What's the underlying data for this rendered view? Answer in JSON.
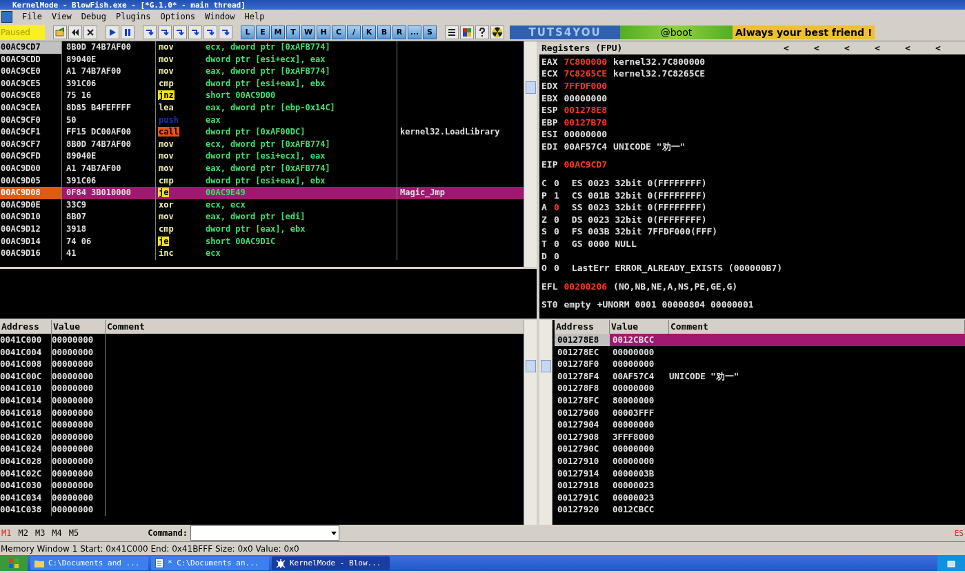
{
  "window": {
    "title": "KernelMode - BlowFish.exe - [*G.1.0* - main thread]"
  },
  "menu": [
    {
      "label": "File"
    },
    {
      "label": "View"
    },
    {
      "label": "Debug"
    },
    {
      "label": "Plugins"
    },
    {
      "label": "Options"
    },
    {
      "label": "Window"
    },
    {
      "label": "Help"
    }
  ],
  "toolbar": {
    "status": "Paused",
    "letter_buttons": [
      "L",
      "E",
      "M",
      "T",
      "W",
      "H",
      "C",
      "/",
      "K",
      "B",
      "R",
      "...",
      "S"
    ],
    "banner": {
      "logo": "TUTS4YOU",
      "tag": "@boot",
      "slogan": "Always your best friend !"
    }
  },
  "disassembly": {
    "rows": [
      {
        "address": "00AC9CD7",
        "hex": "8B0D 74B7AF00",
        "mnemonic": "mov",
        "kind": "plain",
        "operand": "ecx, dword ptr [0xAFB774]",
        "eip": true,
        "selected": false
      },
      {
        "address": "00AC9CDD",
        "hex": "89040E",
        "mnemonic": "mov",
        "kind": "plain",
        "operand": "dword ptr [esi+ecx], eax",
        "eip": false,
        "selected": false
      },
      {
        "address": "00AC9CE0",
        "hex": "A1 74B7AF00",
        "mnemonic": "mov",
        "kind": "plain",
        "operand": "eax, dword ptr [0xAFB774]",
        "eip": false,
        "selected": false
      },
      {
        "address": "00AC9CE5",
        "hex": "391C06",
        "mnemonic": "cmp",
        "kind": "plain",
        "operand": "dword ptr [esi+eax], ebx",
        "eip": false,
        "selected": false
      },
      {
        "address": "00AC9CE8",
        "hex": "75 16",
        "mnemonic": "jnz",
        "kind": "jump",
        "operand": "short 00AC9D00",
        "eip": false,
        "selected": false
      },
      {
        "address": "00AC9CEA",
        "hex": "8D85 B4FEFFFF",
        "mnemonic": "lea",
        "kind": "plain",
        "operand": "eax, dword ptr [ebp-0x14C]",
        "eip": false,
        "selected": false
      },
      {
        "address": "00AC9CF0",
        "hex": "50",
        "mnemonic": "push",
        "kind": "push",
        "operand": "eax",
        "eip": false,
        "selected": false
      },
      {
        "address": "00AC9CF1",
        "hex": "FF15 DC00AF00",
        "mnemonic": "call",
        "kind": "call",
        "operand": "dword ptr [0xAF00DC]",
        "comment": "kernel32.LoadLibrary",
        "eip": false,
        "selected": false
      },
      {
        "address": "00AC9CF7",
        "hex": "8B0D 74B7AF00",
        "mnemonic": "mov",
        "kind": "plain",
        "operand": "ecx, dword ptr [0xAFB774]",
        "eip": false,
        "selected": false
      },
      {
        "address": "00AC9CFD",
        "hex": "89040E",
        "mnemonic": "mov",
        "kind": "plain",
        "operand": "dword ptr [esi+ecx], eax",
        "eip": false,
        "selected": false
      },
      {
        "address": "00AC9D00",
        "hex": "A1 74B7AF00",
        "mnemonic": "mov",
        "kind": "plain",
        "operand": "eax, dword ptr [0xAFB774]",
        "eip": false,
        "selected": false
      },
      {
        "address": "00AC9D05",
        "hex": "391C06",
        "mnemonic": "cmp",
        "kind": "plain",
        "operand": "dword ptr [esi+eax], ebx",
        "eip": false,
        "selected": false
      },
      {
        "address": "00AC9D08",
        "hex": "0F84 3B010000",
        "mnemonic": "je",
        "kind": "jump",
        "operand": "00AC9E49",
        "comment": "Magic_Jmp",
        "eip": false,
        "selected": true
      },
      {
        "address": "00AC9D0E",
        "hex": "33C9",
        "mnemonic": "xor",
        "kind": "plain",
        "operand": "ecx, ecx",
        "eip": false,
        "selected": false
      },
      {
        "address": "00AC9D10",
        "hex": "8B07",
        "mnemonic": "mov",
        "kind": "plain",
        "operand": "eax, dword ptr [edi]",
        "eip": false,
        "selected": false
      },
      {
        "address": "00AC9D12",
        "hex": "3918",
        "mnemonic": "cmp",
        "kind": "plain",
        "operand": "dword ptr [eax], ebx",
        "eip": false,
        "selected": false
      },
      {
        "address": "00AC9D14",
        "hex": "74 06",
        "mnemonic": "je",
        "kind": "jump",
        "operand": "short 00AC9D1C",
        "eip": false,
        "selected": false
      },
      {
        "address": "00AC9D16",
        "hex": "41",
        "mnemonic": "inc",
        "kind": "plain",
        "operand": "ecx",
        "eip": false,
        "selected": false
      }
    ]
  },
  "registers": {
    "title": "Registers (FPU)",
    "arrows": [
      "<",
      "<",
      "<",
      "<",
      "<",
      "<"
    ],
    "groups": [
      [
        {
          "name": "EAX",
          "value": "7C800000",
          "changed": true,
          "info": "kernel32.7C800000"
        },
        {
          "name": "ECX",
          "value": "7C8265CE",
          "changed": true,
          "info": "kernel32.7C8265CE"
        },
        {
          "name": "EDX",
          "value": "7FFDF000",
          "changed": true
        },
        {
          "name": "EBX",
          "value": "00000000",
          "changed": false
        },
        {
          "name": "ESP",
          "value": "001278E8",
          "changed": true
        },
        {
          "name": "EBP",
          "value": "00127B70",
          "changed": true
        },
        {
          "name": "ESI",
          "value": "00000000",
          "changed": false
        },
        {
          "name": "EDI",
          "value": "00AF57C4",
          "changed": false,
          "info": "UNICODE \"劝一\""
        }
      ],
      [
        {
          "name": "EIP",
          "value": "00AC9CD7",
          "changed": true
        }
      ],
      [
        {
          "name": "C",
          "value": "0",
          "changed": false,
          "info": "ES 0023 32bit 0(FFFFFFFF)"
        },
        {
          "name": "P",
          "value": "1",
          "changed": false,
          "info": "CS 001B 32bit 0(FFFFFFFF)"
        },
        {
          "name": "A",
          "value": "0",
          "changed": true,
          "info": "SS 0023 32bit 0(FFFFFFFF)"
        },
        {
          "name": "Z",
          "value": "0",
          "changed": false,
          "info": "DS 0023 32bit 0(FFFFFFFF)"
        },
        {
          "name": "S",
          "value": "0",
          "changed": false,
          "info": "FS 003B 32bit 7FFDF000(FFF)"
        },
        {
          "name": "T",
          "value": "0",
          "changed": false,
          "info": "GS 0000 NULL"
        },
        {
          "name": "D",
          "value": "0",
          "changed": false
        },
        {
          "name": "O",
          "value": "0",
          "changed": false,
          "info": "LastErr ERROR_ALREADY_EXISTS (000000B7)"
        }
      ],
      [
        {
          "name": "EFL",
          "value": "00200206",
          "changed": true,
          "info": "(NO,NB,NE,A,NS,PE,GE,G)"
        }
      ],
      [
        {
          "name": "ST0",
          "value": "empty",
          "changed": false,
          "info": "+UNORM 0001 00000804 00000001"
        }
      ]
    ]
  },
  "dump": {
    "columns": [
      "Address",
      "Value",
      "Comment"
    ],
    "rows": [
      {
        "address": "0041C000",
        "value": "00000000"
      },
      {
        "address": "0041C004",
        "value": "00000000"
      },
      {
        "address": "0041C008",
        "value": "00000000"
      },
      {
        "address": "0041C00C",
        "value": "00000000"
      },
      {
        "address": "0041C010",
        "value": "00000000"
      },
      {
        "address": "0041C014",
        "value": "00000000"
      },
      {
        "address": "0041C018",
        "value": "00000000"
      },
      {
        "address": "0041C01C",
        "value": "00000000"
      },
      {
        "address": "0041C020",
        "value": "00000000"
      },
      {
        "address": "0041C024",
        "value": "00000000"
      },
      {
        "address": "0041C028",
        "value": "00000000"
      },
      {
        "address": "0041C02C",
        "value": "00000000"
      },
      {
        "address": "0041C030",
        "value": "00000000"
      },
      {
        "address": "0041C034",
        "value": "00000000"
      },
      {
        "address": "0041C038",
        "value": "00000000"
      }
    ]
  },
  "stack": {
    "columns": [
      "Address",
      "Value",
      "Comment"
    ],
    "rows": [
      {
        "address": "001278E8",
        "value": "0012CBCC",
        "selected": true
      },
      {
        "address": "001278EC",
        "value": "00000000",
        "selected": false
      },
      {
        "address": "001278F0",
        "value": "00000000",
        "selected": false
      },
      {
        "address": "001278F4",
        "value": "00AF57C4",
        "comment": "UNICODE \"劝一\"",
        "selected": false
      },
      {
        "address": "001278F8",
        "value": "00000000",
        "selected": false
      },
      {
        "address": "001278FC",
        "value": "80000000",
        "selected": false
      },
      {
        "address": "00127900",
        "value": "00003FFF",
        "selected": false
      },
      {
        "address": "00127904",
        "value": "00000000",
        "selected": false
      },
      {
        "address": "00127908",
        "value": "3FFF8000",
        "selected": false
      },
      {
        "address": "0012790C",
        "value": "00000000",
        "selected": false
      },
      {
        "address": "00127910",
        "value": "00000000",
        "selected": false
      },
      {
        "address": "00127914",
        "value": "0000003B",
        "selected": false
      },
      {
        "address": "00127918",
        "value": "00000023",
        "selected": false
      },
      {
        "address": "0012791C",
        "value": "00000023",
        "selected": false
      },
      {
        "address": "00127920",
        "value": "0012CBCC",
        "selected": false
      }
    ]
  },
  "command_bar": {
    "memory_tabs": [
      {
        "label": "M1",
        "selected": true
      },
      {
        "label": "M2",
        "selected": false
      },
      {
        "label": "M3",
        "selected": false
      },
      {
        "label": "M4",
        "selected": false
      },
      {
        "label": "M5",
        "selected": false
      }
    ],
    "command_label": "Command:",
    "corner": "ES"
  },
  "status_bar": "Memory Window 1  Start: 0x41C000  End: 0x41BFFF  Size: 0x0 Value: 0x0",
  "taskbar": [
    {
      "label": "C:\\Documents and ...",
      "kind": "folder",
      "selected": false
    },
    {
      "label": "* C:\\Documents an...",
      "kind": "editor",
      "selected": false
    },
    {
      "label": "KernelMode - Blow...",
      "kind": "debugger",
      "selected": true
    }
  ]
}
